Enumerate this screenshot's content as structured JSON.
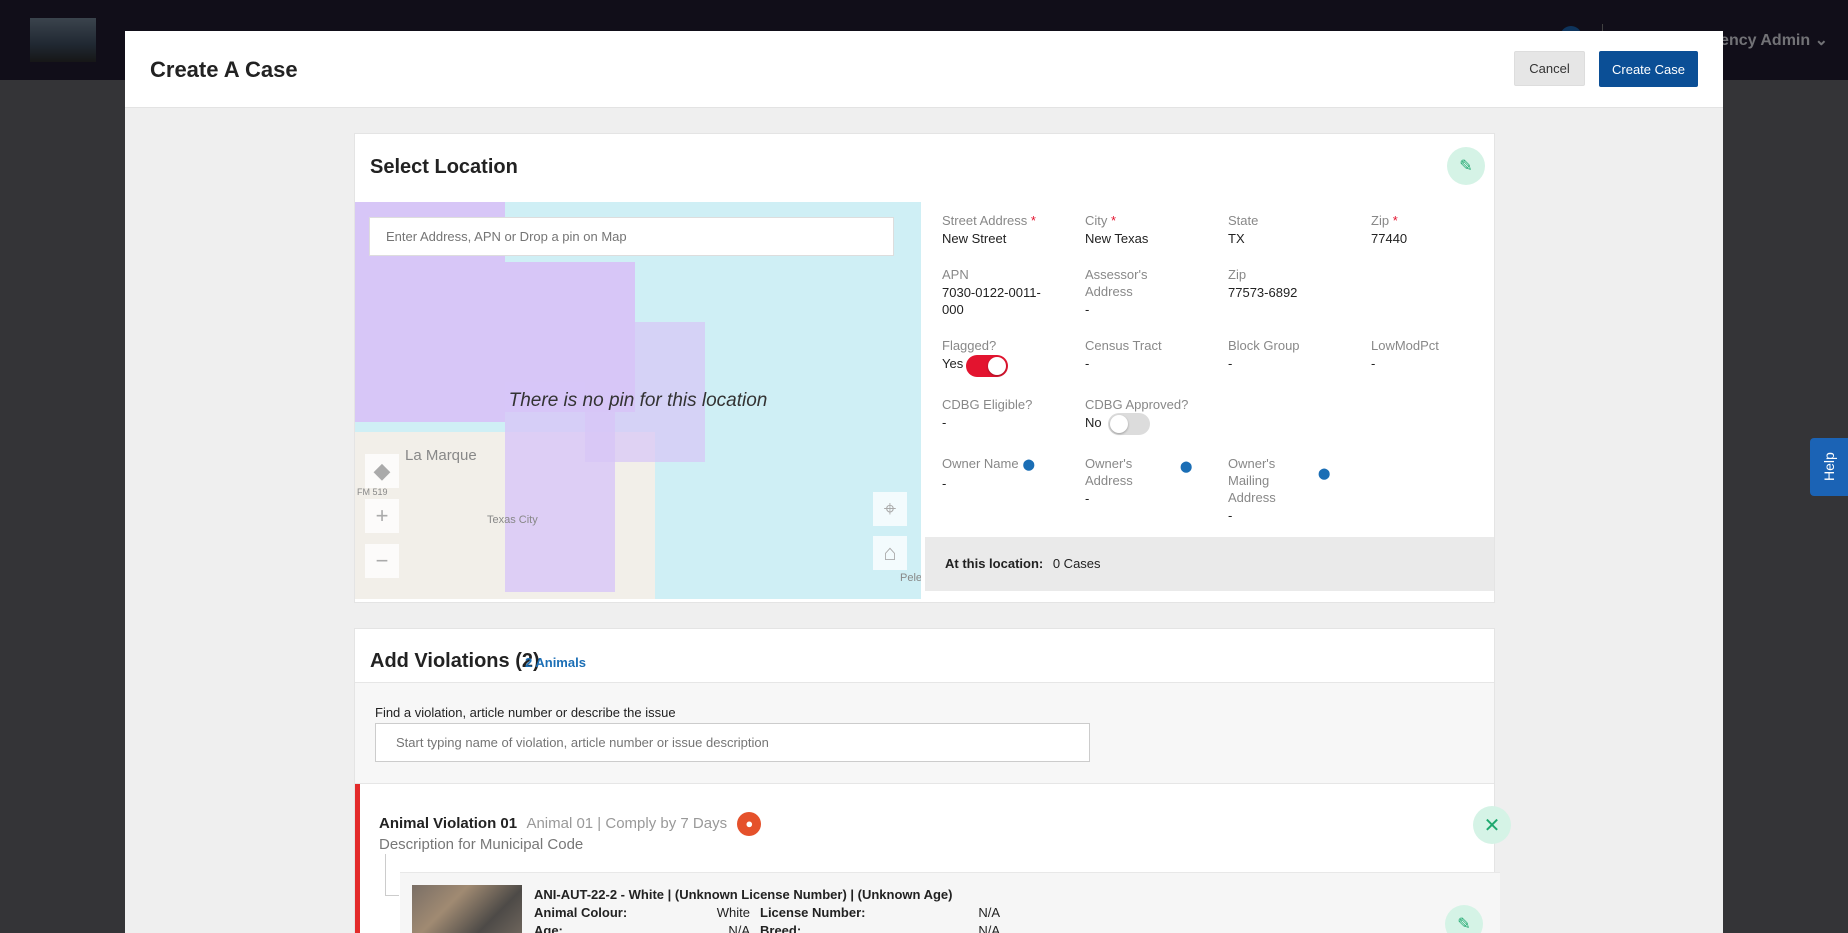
{
  "app": {
    "user_label": "ency Admin",
    "user_chevron": "⌄"
  },
  "help_label": "Help",
  "modal": {
    "title": "Create A Case",
    "cancel_label": "Cancel",
    "create_label": "Create Case"
  },
  "location": {
    "title": "Select Location",
    "search_placeholder": "Enter Address, APN or Drop a pin on Map",
    "no_pin_message": "There is no pin for this location",
    "map_labels": {
      "town": "La Marque",
      "road": "FM 519",
      "area": "Texas City",
      "pe": "Pele"
    },
    "fields": {
      "street_label": "Street Address",
      "street_value": "New Street",
      "city_label": "City",
      "city_value": "New Texas",
      "state_label": "State",
      "state_value": "TX",
      "zip_label": "Zip",
      "zip_value": "77440",
      "apn_label": "APN",
      "apn_value": "7030-0122-0011-000",
      "assessor_label": "Assessor's Address",
      "assessor_value": "-",
      "zip2_label": "Zip",
      "zip2_value": "77573-6892",
      "flagged_label": "Flagged?",
      "flagged_value": "Yes",
      "census_label": "Census Tract",
      "census_value": "-",
      "block_label": "Block Group",
      "block_value": "-",
      "lowmod_label": "LowModPct",
      "lowmod_value": "-",
      "cdbg_elig_label": "CDBG Eligible?",
      "cdbg_elig_value": "-",
      "cdbg_appr_label": "CDBG Approved?",
      "cdbg_appr_value": "No",
      "owner_name_label": "Owner Name",
      "owner_name_value": "-",
      "owner_addr_label": "Owner's Address",
      "owner_addr_value": "-",
      "owner_mail_label": "Owner's Mailing Address",
      "owner_mail_value": "-"
    },
    "flagged_on": true,
    "cdbg_approved_on": false,
    "at_location_label": "At this location:",
    "at_location_value": "0 Cases"
  },
  "violations": {
    "title": "Add Violations (2)",
    "animals_link": "2 Animals",
    "search_label": "Find a violation, article number or describe the issue",
    "search_placeholder": "Start typing name of violation, article number or issue description",
    "item": {
      "name": "Animal Violation 01",
      "sub": "Animal 01 | Comply by 7 Days",
      "description": "Description for Municipal Code",
      "animal_title": "ANI-AUT-22-2 - White | (Unknown License Number) | (Unknown Age)",
      "colour_label": "Animal Colour:",
      "colour_value": "White",
      "license_label": "License Number:",
      "license_value": "N/A",
      "age_label": "Age:",
      "age_value": "N/A",
      "breed_label": "Breed:",
      "breed_value": "N/A"
    }
  },
  "colors": {
    "accent": "#0b4f96",
    "toggle_on": "#e3142f",
    "violation_bar": "#e32b2b",
    "edit_circle": "#d5f3e6"
  }
}
